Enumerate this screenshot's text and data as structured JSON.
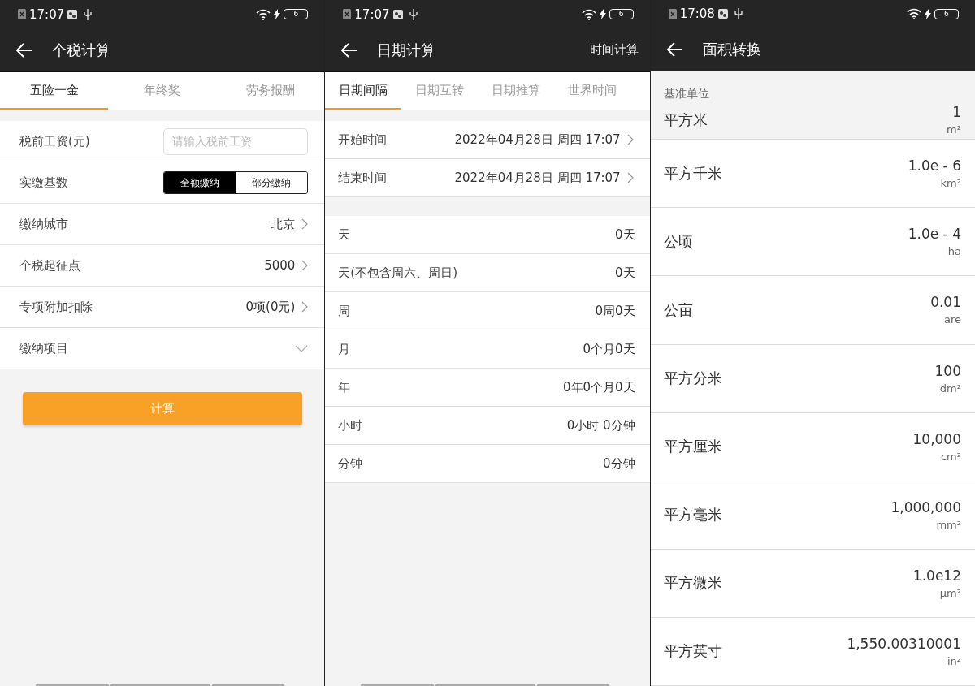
{
  "screens": [
    {
      "status_bar": {
        "time": "17:07",
        "battery": "6"
      },
      "toolbar": {
        "title": "个税计算"
      },
      "tabs": [
        {
          "label": "五险一金",
          "selected": true
        },
        {
          "label": "年终奖",
          "selected": false
        },
        {
          "label": "劳务报酬",
          "selected": false
        }
      ],
      "form": [
        {
          "kind": "input",
          "label": "税前工资(元)",
          "placeholder": "请输入税前工资"
        },
        {
          "kind": "segmented",
          "label": "实缴基数",
          "options": [
            {
              "label": "全额缴纳",
              "selected": true
            },
            {
              "label": "部分缴纳",
              "selected": false
            }
          ]
        },
        {
          "kind": "link",
          "label": "缴纳城市",
          "value": "北京"
        },
        {
          "kind": "link",
          "label": "个税起征点",
          "value": "5000"
        },
        {
          "kind": "link",
          "label": "专项附加扣除",
          "value": "0项(0元)"
        },
        {
          "kind": "expand",
          "label": "缴纳项目",
          "expanded": false
        }
      ],
      "button": "计算"
    },
    {
      "status_bar": {
        "time": "17:07",
        "battery": "6"
      },
      "toolbar": {
        "title": "日期计算",
        "action": "时间计算"
      },
      "tabs": [
        {
          "label": "日期间隔",
          "selected": true
        },
        {
          "label": "日期互转",
          "selected": false
        },
        {
          "label": "日期推算",
          "selected": false
        },
        {
          "label": "世界时间",
          "selected": false
        }
      ],
      "inputs": [
        {
          "label": "开始时间",
          "value": "2022年04月28日 周四 17:07"
        },
        {
          "label": "结束时间",
          "value": "2022年04月28日 周四 17:07"
        }
      ],
      "results": [
        {
          "label": "天",
          "value": "0天"
        },
        {
          "label": "天(不包含周六、周日)",
          "value": "0天"
        },
        {
          "label": "周",
          "value": "0周0天"
        },
        {
          "label": "月",
          "value": "0个月0天"
        },
        {
          "label": "年",
          "value": "0年0个月0天"
        },
        {
          "label": "小时",
          "value": "0小时 0分钟"
        },
        {
          "label": "分钟",
          "value": "0分钟"
        }
      ]
    },
    {
      "status_bar": {
        "time": "17:08",
        "battery": "6"
      },
      "toolbar": {
        "title": "面积转换"
      },
      "section": "基准单位",
      "units": [
        {
          "name": "平方米",
          "value": "1",
          "unit": "m²",
          "base": true
        },
        {
          "name": "平方千米",
          "value": "1.0e - 6",
          "unit": "km²",
          "base": false
        },
        {
          "name": "公顷",
          "value": "1.0e - 4",
          "unit": "ha",
          "base": false
        },
        {
          "name": "公亩",
          "value": "0.01",
          "unit": "are",
          "base": false
        },
        {
          "name": "平方分米",
          "value": "100",
          "unit": "dm²",
          "base": false
        },
        {
          "name": "平方厘米",
          "value": "10,000",
          "unit": "cm²",
          "base": false
        },
        {
          "name": "平方毫米",
          "value": "1,000,000",
          "unit": "mm²",
          "base": false
        },
        {
          "name": "平方微米",
          "value": "1.0e12",
          "unit": "µm²",
          "base": false
        },
        {
          "name": "平方英寸",
          "value": "1,550.00310001",
          "unit": "in²",
          "base": false
        }
      ]
    }
  ]
}
